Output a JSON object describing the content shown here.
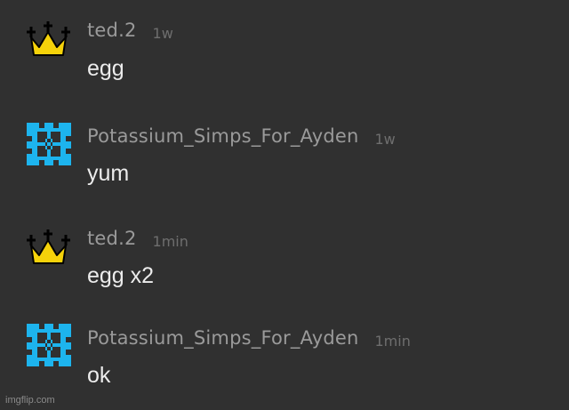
{
  "messages": [
    {
      "username": "ted.2",
      "time": "1w",
      "text": "egg",
      "avatar_icon": "crown-icon"
    },
    {
      "username": "Potassium_Simps_For_Ayden",
      "time": "1w",
      "text": "yum",
      "avatar_icon": "hash-block-icon"
    },
    {
      "username": "ted.2",
      "time": "1min",
      "text": "egg x2",
      "avatar_icon": "crown-icon"
    },
    {
      "username": "Potassium_Simps_For_Ayden",
      "time": "1min",
      "text": "ok",
      "avatar_icon": "hash-block-icon"
    }
  ],
  "watermark": "imgflip.com",
  "colors": {
    "background": "#303030",
    "username": "#9a9a9a",
    "timestamp": "#6e6e6e",
    "message_text": "#ececec",
    "crown": "#f5d20a",
    "hash_avatar": "#1db4ee"
  }
}
